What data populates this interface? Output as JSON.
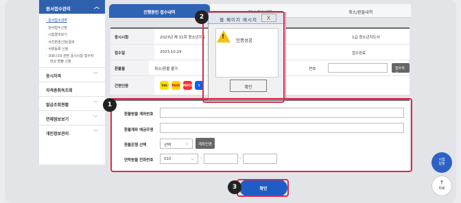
{
  "sidebar": {
    "header": "원서접수관리",
    "sub_items": [
      "원서접수내역",
      "원서접수신청",
      "시험결과보기",
      "사진변경신청/결과",
      "서류등록 신청",
      "코로나19 관련 응시시험 접수자",
      "대상 환불 신청"
    ],
    "rows": [
      "응시자격",
      "자격증취득조회",
      "발급조회현황",
      "연체정보보기",
      "개인정보관리"
    ]
  },
  "tabs": [
    "진행중인 접수내역",
    "지난 접수내역",
    "취소/환불내역"
  ],
  "info": {
    "rows": [
      {
        "label": "응시시험",
        "value": "2023년 제 31회 청소년지도",
        "right_value": "1급 청소년지도사"
      },
      {
        "label": "접수일",
        "value": "2023.10.19",
        "right_value": "접수완료"
      },
      {
        "label": "환불율",
        "value": "취소/환불 불가",
        "right_label": "번호",
        "right_button": "접수취소"
      },
      {
        "label": "간편인증",
        "icons": [
          "kakao",
          "pass",
          "payco",
          "toss"
        ]
      }
    ],
    "icon_texts": [
      "Talk",
      "PASS",
      "PAYCO",
      "t"
    ]
  },
  "refund_form": {
    "account_number_label": "환불받을 계좌번호",
    "holder_label": "환불계좌 예금주명",
    "bank_label": "환불은행 선택",
    "bank_select": "선택",
    "verify_button": "계좌인증",
    "phone_label": "연락받을 전화번호",
    "phone_prefix": "010",
    "dash": "-"
  },
  "confirm_button": "확인",
  "dialog": {
    "title": "웹 페이지 메시지",
    "close": "X",
    "message": "인증성공",
    "ok": "확인"
  },
  "callouts": [
    "1",
    "2",
    "3"
  ],
  "fab": {
    "exam_line1": "시험",
    "exam_line2": "일정",
    "top_label": "위로"
  },
  "colors": {
    "primary": "#2e60ad",
    "highlight": "#d7294a",
    "button": "#1f5cc6"
  }
}
